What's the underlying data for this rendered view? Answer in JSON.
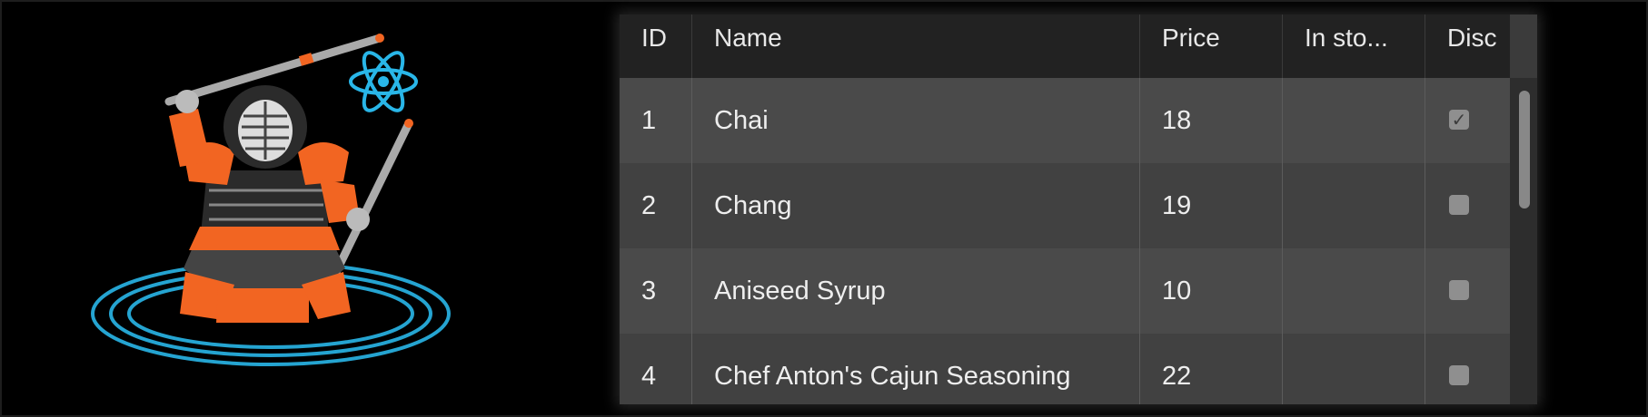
{
  "logo": {
    "name": "kendo-ninja-react-logo"
  },
  "grid": {
    "columns": [
      "ID",
      "Name",
      "Price",
      "In sto...",
      "Disc"
    ],
    "rows": [
      {
        "id": "1",
        "name": "Chai",
        "price": "18",
        "in_stock": "",
        "discontinued": true
      },
      {
        "id": "2",
        "name": "Chang",
        "price": "19",
        "in_stock": "",
        "discontinued": false
      },
      {
        "id": "3",
        "name": "Aniseed Syrup",
        "price": "10",
        "in_stock": "",
        "discontinued": false
      },
      {
        "id": "4",
        "name": "Chef Anton's Cajun Seasoning",
        "price": "22",
        "in_stock": "",
        "discontinued": false
      }
    ]
  },
  "colors": {
    "background": "#000000",
    "header": "#222222",
    "row_odd": "#4a4a4a",
    "row_even": "#414141",
    "accent_orange": "#f26522",
    "accent_blue": "#29b6e8"
  }
}
